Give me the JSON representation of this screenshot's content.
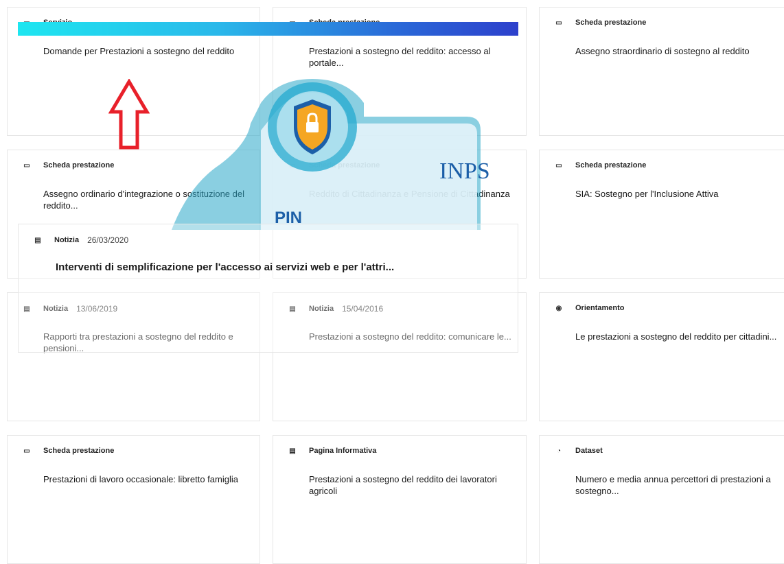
{
  "cards": [
    {
      "type": "Servizio",
      "title": "Domande per Prestazioni a sostegno del reddito",
      "icon": "lock-icon"
    },
    {
      "type": "Scheda prestazione",
      "title": "Prestazioni a sostegno del reddito: accesso al portale...",
      "icon": "lock-icon"
    },
    {
      "type": "Scheda prestazione",
      "title": "Assegno straordinario di sostegno al reddito",
      "icon": "lock-icon"
    },
    {
      "type": "Scheda prestazione",
      "title": "Assegno ordinario d'integrazione o sostituzione del reddito...",
      "icon": "lock-icon"
    },
    {
      "type": "Scheda prestazione",
      "title": "Reddito di Cittadinanza e Pensione di Cittadinanza",
      "icon": "lock-icon"
    },
    {
      "type": "Scheda prestazione",
      "title": "SIA: Sostegno per l'Inclusione Attiva",
      "icon": "lock-icon"
    },
    {
      "type": "Notizia",
      "date": "13/06/2019",
      "title": "Rapporti tra prestazioni a sostegno del reddito e pensioni...",
      "icon": "newspaper-icon"
    },
    {
      "type": "Notizia",
      "date": "15/04/2016",
      "title": "Prestazioni a sostegno del reddito: comunicare le...",
      "icon": "newspaper-icon"
    },
    {
      "type": "Orientamento",
      "title": "Le prestazioni a sostegno del reddito per cittadini...",
      "icon": "compass-icon"
    },
    {
      "type": "Scheda prestazione",
      "title": "Prestazioni di lavoro occasionale: libretto famiglia",
      "icon": "lock-icon"
    },
    {
      "type": "Pagina Informativa",
      "title": "Prestazioni a sostegno del reddito dei lavoratori agricoli",
      "icon": "document-icon"
    },
    {
      "type": "Dataset",
      "title": "Numero e media annua percettori di prestazioni a sostegno...",
      "icon": "pie-chart-icon"
    }
  ],
  "overlay_news": {
    "type": "Notizia",
    "date": "26/03/2020",
    "title": "Interventi di semplificazione per l'accesso ai servizi web e per l'attri..."
  },
  "watermark": {
    "brand": "INPS",
    "pin": "PIN"
  },
  "colors": {
    "banner_start": "#1ee6f0",
    "banner_end": "#2d40cc",
    "arrow": "#e8202a",
    "pin_blue": "#1c5fa8",
    "shield_orange": "#f5a623"
  }
}
